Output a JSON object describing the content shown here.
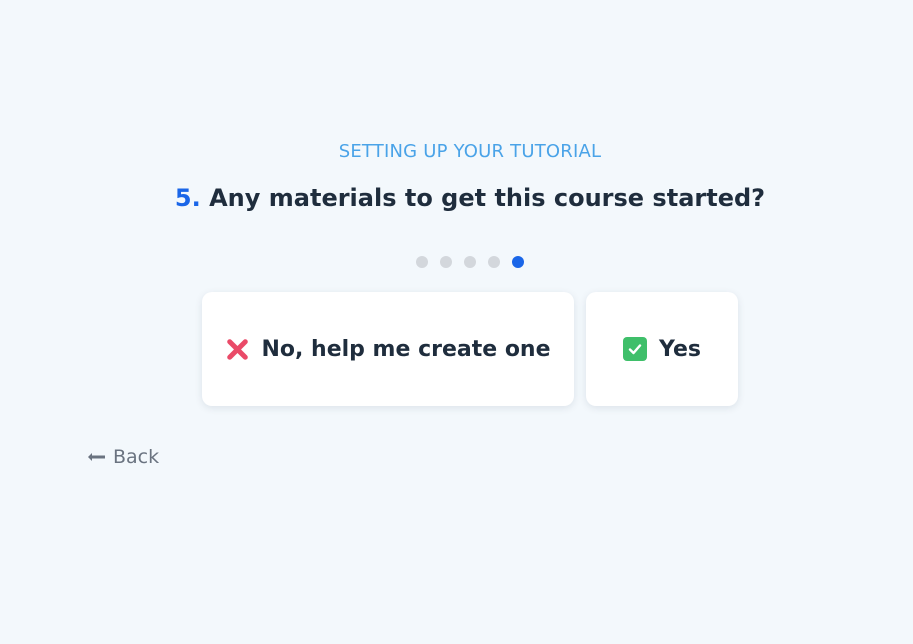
{
  "header": {
    "step_title": "SETTING UP YOUR TUTORIAL",
    "question_number": "5.",
    "question_text": "Any materials to get this course started?"
  },
  "progress": {
    "total_steps": 5,
    "current_step": 5
  },
  "options": [
    {
      "label": "No, help me create one",
      "icon": "cross-mark-icon"
    },
    {
      "label": "Yes",
      "icon": "check-mark-icon"
    }
  ],
  "nav": {
    "back_label": "Back",
    "back_icon": "left-arrow-icon"
  },
  "colors": {
    "accent": "#1a66e8",
    "step_title": "#4aa3e8",
    "background": "#f3f8fc",
    "dot_inactive": "#d3d7dc",
    "cross": "#ea4a68",
    "check": "#3fbf6a"
  }
}
